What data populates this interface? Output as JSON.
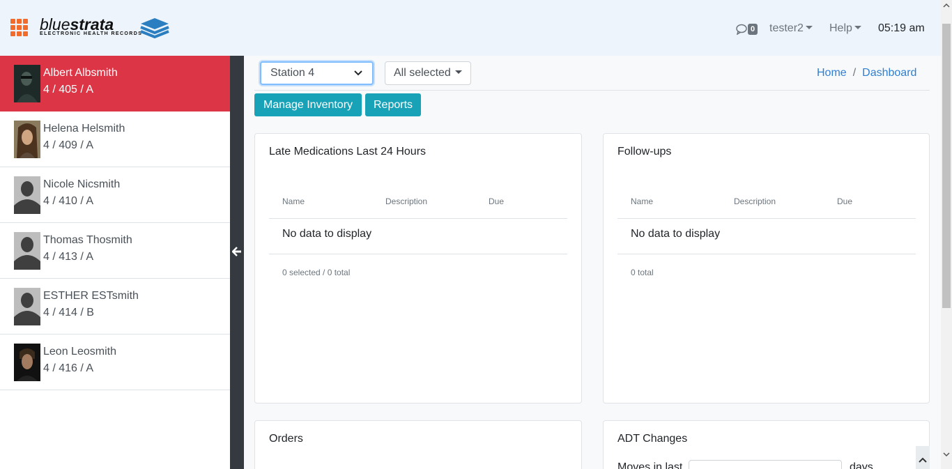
{
  "header": {
    "logo_word_light": "blue",
    "logo_word_bold": "strata",
    "logo_tagline": "ELECTRONIC HEALTH RECORDS",
    "messages_count": "0",
    "user": "tester2",
    "help": "Help",
    "time": "05:19 am"
  },
  "patients": [
    {
      "name": "Albert Albsmith",
      "info": "4 / 405 / A",
      "photo": "dark-figure"
    },
    {
      "name": "Helena Helsmith",
      "info": "4 / 409 / A",
      "photo": "woman-portrait"
    },
    {
      "name": "Nicole Nicsmith",
      "info": "4 / 410 / A",
      "photo": "silhouette"
    },
    {
      "name": "Thomas Thosmith",
      "info": "4 / 413 / A",
      "photo": "silhouette"
    },
    {
      "name": "ESTHER ESTsmith",
      "info": "4 / 414 / B",
      "photo": "silhouette"
    },
    {
      "name": "Leon Leosmith",
      "info": "4 / 416 / A",
      "photo": "man-portrait"
    }
  ],
  "filters": {
    "station": "Station 4",
    "multiselect": "All selected"
  },
  "breadcrumb": {
    "home": "Home",
    "sep": "/",
    "current": "Dashboard"
  },
  "buttons": {
    "manage_inventory": "Manage Inventory",
    "reports": "Reports"
  },
  "cards": {
    "late_meds": {
      "title": "Late Medications Last 24 Hours",
      "columns": [
        "Name",
        "Description",
        "Due"
      ],
      "empty": "No data to display",
      "footer": "0 selected / 0 total"
    },
    "followups": {
      "title": "Follow-ups",
      "columns": [
        "Name",
        "Description",
        "Due"
      ],
      "empty": "No data to display",
      "footer": "0 total"
    },
    "orders": {
      "title": "Orders"
    },
    "adt": {
      "title": "ADT Changes",
      "moves_label": "Moves in last",
      "days_label": "days"
    }
  },
  "colors": {
    "active_patient": "#dc3545",
    "button": "#17a2b8",
    "sidebar_divider": "#343a40",
    "header_bg": "#eef4fb",
    "link": "#2f7fd1"
  }
}
